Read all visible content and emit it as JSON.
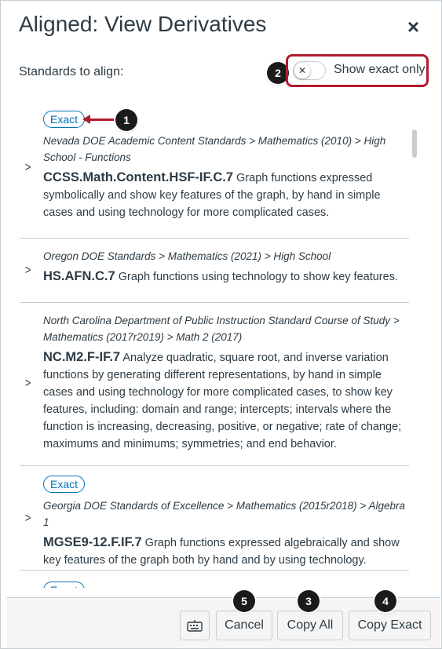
{
  "header": {
    "title": "Aligned: View Derivatives",
    "close_label": "×"
  },
  "subheader": {
    "standards_label": "Standards to align:",
    "toggle_label": "Show exact only",
    "toggle_state": "off",
    "toggle_knob_glyph": "✕"
  },
  "callouts": {
    "c1": "1",
    "c2": "2",
    "c3": "3",
    "c4": "4",
    "c5": "5"
  },
  "items": [
    {
      "exact_badge": "Exact",
      "path": "Nevada DOE Academic Content Standards > Mathematics (2010) > High School - Functions",
      "code": "CCSS.Math.Content.HSF-IF.C.7",
      "description": " Graph functions expressed symbolically and show key features of the graph, by hand in simple cases and using technology for more complicated cases."
    },
    {
      "exact_badge": "",
      "path": "Oregon DOE Standards > Mathematics (2021) > High School",
      "code": "HS.AFN.C.7",
      "description": " Graph functions using technology to show key features."
    },
    {
      "exact_badge": "",
      "path": "North Carolina Department of Public Instruction Standard Course of Study > Mathematics (2017r2019) > Math 2 (2017)",
      "code": "NC.M2.F-IF.7",
      "description": " Analyze quadratic, square root, and inverse variation functions by generating different representations, by hand in simple cases and using technology for more complicated cases, to show key features, including: domain and range; intercepts; intervals where the function is increasing, decreasing, positive, or negative; rate of change; maximums and minimums; symmetries; and end behavior."
    },
    {
      "exact_badge": "Exact",
      "path": "Georgia DOE Standards of Excellence > Mathematics (2015r2018) > Algebra 1",
      "code": "MGSE9-12.F.IF.7",
      "description": " Graph functions expressed algebraically and show key features of the graph both by hand and by using technology."
    },
    {
      "exact_badge": "Exact"
    }
  ],
  "footer": {
    "keyboard_icon": "keyboard-icon",
    "cancel_label": "Cancel",
    "copy_all_label": "Copy All",
    "copy_exact_label": "Copy Exact"
  },
  "colors": {
    "accent": "#0374b5",
    "highlight": "#b01c2e",
    "text": "#2d3b45"
  }
}
